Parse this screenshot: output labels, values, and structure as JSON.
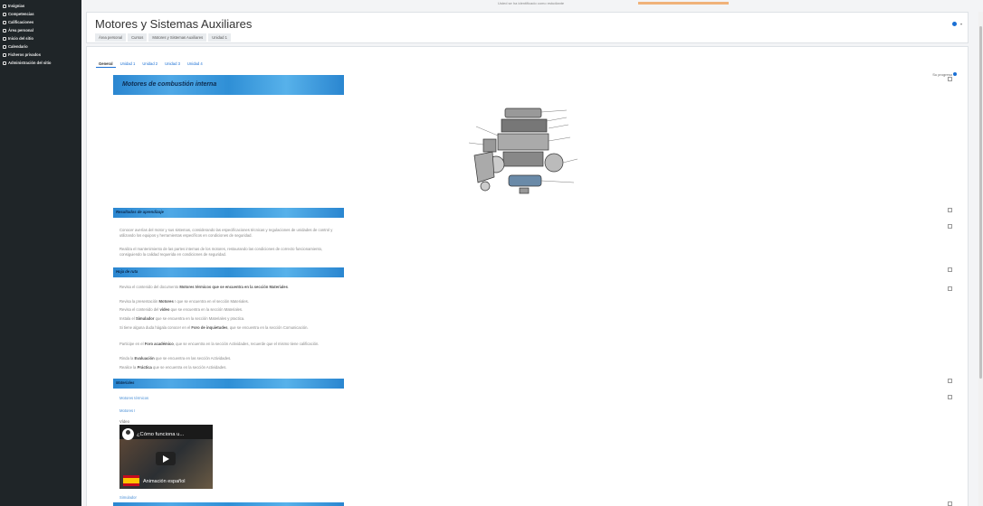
{
  "topstrip": {
    "text": "Usted se ha identificado como estudiante"
  },
  "sidebar": {
    "items": [
      {
        "label": "Insignias",
        "icon": "badge-icon"
      },
      {
        "label": "Competencias",
        "icon": "competencies-icon"
      },
      {
        "label": "Calificaciones",
        "icon": "grades-icon"
      },
      {
        "label": "Área personal",
        "icon": "dashboard-icon"
      },
      {
        "label": "Inicio del sitio",
        "icon": "home-icon"
      },
      {
        "label": "Calendario",
        "icon": "calendar-icon"
      },
      {
        "label": "Ficheros privados",
        "icon": "files-icon"
      },
      {
        "label": "Administración del sitio",
        "icon": "gear-icon"
      }
    ]
  },
  "header": {
    "title": "Motores y Sistemas Auxiliares",
    "breadcrumb": [
      "Área personal",
      "Cursos",
      "Motores y Sistemas Auxiliares",
      "Unidad 1"
    ]
  },
  "tabs": [
    "General",
    "Unidad 1",
    "Unidad 2",
    "Unidad 3",
    "Unidad 4"
  ],
  "progress_label": "Su progreso",
  "sections": {
    "main_banner": "Motores de combustión interna",
    "resultados": "Resultados de aprendizaje",
    "resultados_p1": "Conocer averías del motor y sus sistemas, considerando las especificaciones técnicas y regulaciones de unidades de control y utilizando los equipos y herramientas específicos en condiciones de seguridad.",
    "resultados_p2": "Realiza el mantenimiento de las partes internas de los motores, restaurando las condiciones de correcto funcionamiento, consiguiendo la calidad requerida en condiciones de seguridad.",
    "hoja": "Hoja de ruta",
    "materiales": "Materiales",
    "mat_link1": "Motores térmicos",
    "mat_link2": "Motores I",
    "mat_video_label": "Vídeo",
    "mat_simulador": "Simulador"
  },
  "hoja_steps": [
    {
      "a": "Revisa el contenido del documento ",
      "b": "Motores térmicos que se encuentra en la sección Materiales",
      "c": "."
    },
    {
      "a": "Revisa la presentación ",
      "b": "Motores",
      "c": " I que se encuentra en el sección Materiales."
    },
    {
      "a": "Revisa el contenido del ",
      "b": "vídeo",
      "c": " que se encuentra en la sección Materiales."
    },
    {
      "a": "Instala el ",
      "b": "Simulador",
      "c": " que se encuentra en la sección Materiales y practica."
    },
    {
      "a": "Si tiene alguna duda hágala conocer en el ",
      "b": "Foro de inquietudes",
      "c": ", que se encuentra en la sección Comunicación."
    },
    {
      "a": "Participe en el ",
      "b": "Foro académico",
      "c": ", que se encuentra en la sección Actividades, recuerde que el mismo tiene calificación."
    },
    {
      "a": "Rinda la ",
      "b": "Evaluación",
      "c": " que se encuentra en las sección Actividades."
    },
    {
      "a": "Realice la ",
      "b": "Práctica",
      "c": " que se encuentra en la sección Actividades."
    }
  ],
  "video": {
    "title": "¿Cómo funciona u...",
    "subtitle": "Animación español"
  },
  "colors": {
    "accent": "#1a6fd4",
    "sidebar": "#1f2528",
    "banner": "#2f8fd6"
  }
}
